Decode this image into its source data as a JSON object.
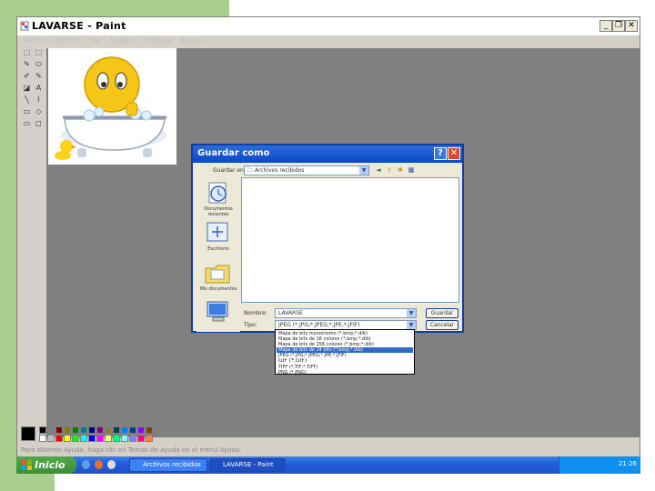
{
  "window": {
    "title": "LAVARSE - Paint",
    "minimize": "_",
    "maximize": "❐",
    "close": "✕"
  },
  "menu": [
    {
      "label": "Archivo"
    },
    {
      "label": "Edición"
    },
    {
      "label": "Ver"
    },
    {
      "label": "Imagen"
    },
    {
      "label": "Colores"
    },
    {
      "label": "Ayuda"
    }
  ],
  "tools": [
    "⬚",
    "⬚",
    "✎",
    "⬭",
    "✐",
    "✎",
    "◪",
    "A",
    "╲",
    "⌇",
    "▭",
    "◇",
    "▭",
    "◻"
  ],
  "palette_colors": [
    "#000000",
    "#808080",
    "#800000",
    "#808000",
    "#008000",
    "#008080",
    "#000080",
    "#800080",
    "#808040",
    "#004040",
    "#0080ff",
    "#004080",
    "#8000ff",
    "#804000",
    "#ffffff",
    "#c0c0c0",
    "#ff0000",
    "#ffff00",
    "#00ff00",
    "#00ffff",
    "#0000ff",
    "#ff00ff",
    "#ffff80",
    "#00ff80",
    "#80ffff",
    "#8080ff",
    "#ff0080",
    "#ff8040"
  ],
  "status_text": "Para obtener Ayuda, haga clic en Temas de Ayuda en el menú Ayuda.",
  "dialog": {
    "title": "Guardar como",
    "help": "?",
    "close": "✕",
    "save_in_label": "Guardar en:",
    "save_in_value": "Archivos recibidos",
    "places": [
      {
        "label": "Documentos recientes"
      },
      {
        "label": "Escritorio"
      },
      {
        "label": "Mis documentos"
      },
      {
        "label": "Mi PC"
      }
    ],
    "name_label": "Nombre:",
    "name_value": "LAVARSE",
    "type_label": "Tipo:",
    "type_value": "JPEG (*.JPG;*.JPEG;*.JPE;*.JFIF)",
    "save_button": "Guardar",
    "cancel_button": "Cancelar",
    "type_options": [
      {
        "label": "Mapa de bits monocromo (*.bmp;*.dib)",
        "selected": false,
        "big": false
      },
      {
        "label": "Mapa de bits de 16 colores (*.bmp;*.dib)",
        "selected": false,
        "big": false
      },
      {
        "label": "Mapa de bits de 256 colores (*.bmp;*.dib)",
        "selected": false,
        "big": false
      },
      {
        "label": "Mapa de bits de 24 bits (*.bmp;*.dib)",
        "selected": true,
        "big": false
      },
      {
        "label": "JPEG (*.JPG;*.JPEG;*.JPE;*.JFIF)",
        "selected": false,
        "big": false
      },
      {
        "label": "GIF (*.GIF)",
        "selected": false,
        "big": true
      },
      {
        "label": "TIFF (*.TIF;*.TIFF)",
        "selected": false,
        "big": false
      },
      {
        "label": "PNG (*.PNG)",
        "selected": false,
        "big": false
      }
    ]
  },
  "taskbar": {
    "start_label": "Inicio",
    "tasks": [
      {
        "label": "Archivos recibidos"
      },
      {
        "label": "LAVARSE - Paint"
      }
    ],
    "clock": "21:26"
  }
}
